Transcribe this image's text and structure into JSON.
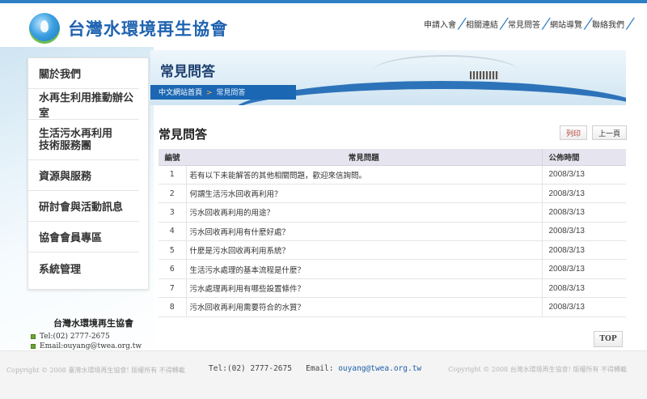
{
  "header": {
    "site_name": "台灣水環境再生協會",
    "nav": [
      "申請入會",
      "相關連結",
      "常見問答",
      "網站導覽",
      "聯絡我們"
    ]
  },
  "sidebar": {
    "items": [
      {
        "label": "關於我們"
      },
      {
        "label": "水再生利用推動辦公室"
      },
      {
        "label": "生活污水再利用\n技術服務團"
      },
      {
        "label": "資源與服務"
      },
      {
        "label": "研討會與活動訊息"
      },
      {
        "label": "協會會員專區"
      },
      {
        "label": "系統管理"
      }
    ],
    "org_name": "台灣水環境再生協會",
    "tel": "Tel:(02) 2777-2675",
    "email": "Email:ouyang@twea.org.tw"
  },
  "banner": {
    "title": "常見問答",
    "breadcrumb_home": "中文網站首頁",
    "breadcrumb_sep": ">",
    "breadcrumb_current": "常見問答"
  },
  "main": {
    "title": "常見問答",
    "print_label": "列印",
    "prev_label": "上一頁",
    "columns": {
      "num": "編號",
      "question": "常見問題",
      "date": "公佈時間"
    },
    "rows": [
      {
        "num": "1",
        "question": "若有以下未能解答的其他相關問題，歡迎來信詢問。",
        "date": "2008/3/13"
      },
      {
        "num": "2",
        "question": "何謂生活污水回收再利用？",
        "date": "2008/3/13"
      },
      {
        "num": "3",
        "question": "污水回收再利用的用途？",
        "date": "2008/3/13"
      },
      {
        "num": "4",
        "question": "污水回收再利用有什麼好處？",
        "date": "2008/3/13"
      },
      {
        "num": "5",
        "question": "什麼是污水回收再利用系統？",
        "date": "2008/3/13"
      },
      {
        "num": "6",
        "question": "生活污水處理的基本流程是什麼？",
        "date": "2008/3/13"
      },
      {
        "num": "7",
        "question": "污水處理再利用有哪些設置條件？",
        "date": "2008/3/13"
      },
      {
        "num": "8",
        "question": "污水回收再利用需要符合的水質？",
        "date": "2008/3/13"
      }
    ],
    "top_label": "TOP"
  },
  "footer": {
    "left": "Copyright © 2008 臺灣水環境再生協會! 版權所有 不得轉載",
    "tel": "Tel:(02) 2777-2675",
    "email_label": "Email:",
    "email": "ouyang@twea.org.tw",
    "right": "Copyright © 2008 台灣水環境再生協會! 版權所有 不得轉載"
  }
}
